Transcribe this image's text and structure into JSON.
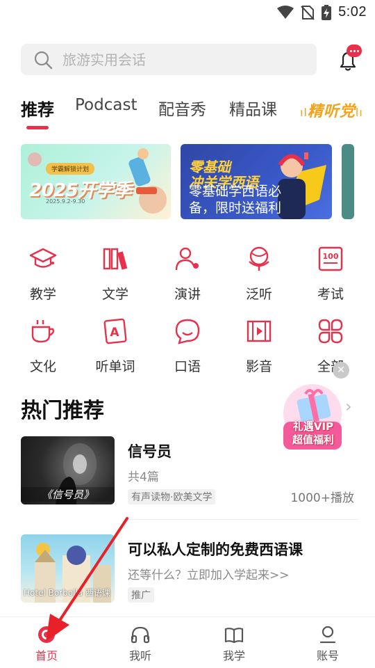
{
  "status_bar": {
    "time": "5:02"
  },
  "search": {
    "placeholder": "旅游实用会话"
  },
  "tabs": [
    {
      "label": "推荐",
      "active": true
    },
    {
      "label": "Podcast"
    },
    {
      "label": "配音秀"
    },
    {
      "label": "精品课"
    },
    {
      "label": "精听党"
    }
  ],
  "banners": [
    {
      "tag": "学霸解锁计划",
      "title": "2025开学季",
      "date": "2025.9.2-9.30"
    },
    {
      "title": "零基础\n冲关学西语",
      "subtitle": "零基础学西语必备，限时送福利"
    }
  ],
  "categories": [
    {
      "label": "教学",
      "icon": "graduation-cap-icon"
    },
    {
      "label": "文学",
      "icon": "books-icon"
    },
    {
      "label": "演讲",
      "icon": "speaker-person-icon"
    },
    {
      "label": "泛听",
      "icon": "globe-icon"
    },
    {
      "label": "考试",
      "icon": "score-100-icon"
    },
    {
      "label": "文化",
      "icon": "coffee-cup-icon"
    },
    {
      "label": "听单词",
      "icon": "word-card-icon"
    },
    {
      "label": "口语",
      "icon": "speech-bubble-icon"
    },
    {
      "label": "影音",
      "icon": "film-icon"
    },
    {
      "label": "全部",
      "icon": "grid-all-icon"
    }
  ],
  "section": {
    "title": "热门推荐"
  },
  "vip_float": {
    "line1": "礼遇VIP",
    "line2": "超值福利"
  },
  "items": [
    {
      "title": "信号员",
      "subtitle": "共4篇",
      "tag": "有声读物·欧美文学",
      "plays": "1000+播放",
      "thumb_caption": "《信号员》"
    },
    {
      "title": "可以私人定制的免费西语课",
      "subtitle": "还等什么？立即加入学起来>>",
      "tag": "推广",
      "thumb_caption": "Hotel Borbolla 西语课"
    }
  ],
  "bottom_nav": [
    {
      "label": "首页",
      "active": true
    },
    {
      "label": "我听"
    },
    {
      "label": "我学"
    },
    {
      "label": "账号"
    }
  ],
  "colors": {
    "accent": "#e8304b",
    "gold": "#f4a21a"
  }
}
